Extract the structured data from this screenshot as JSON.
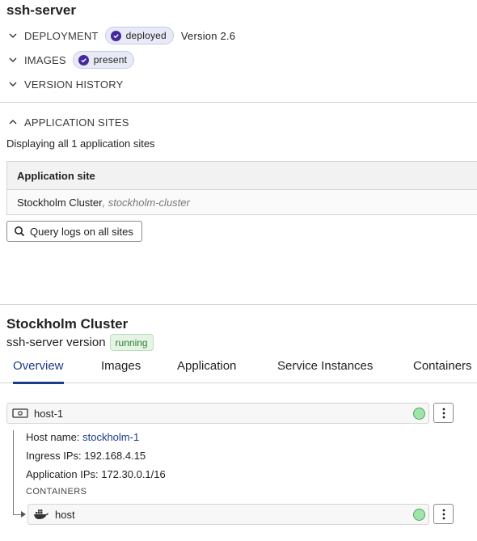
{
  "app": {
    "title": "ssh-server"
  },
  "sections": {
    "deployment": {
      "label": "DEPLOYMENT",
      "badge": "deployed",
      "version": "Version 2.6"
    },
    "images": {
      "label": "IMAGES",
      "badge": "present"
    },
    "version_history": {
      "label": "VERSION HISTORY"
    },
    "application_sites": {
      "label": "APPLICATION SITES",
      "summary": "Displaying all 1 application sites"
    }
  },
  "sites_table": {
    "header": "Application site",
    "rows": [
      {
        "name": "Stockholm Cluster",
        "slug": ", stockholm-cluster"
      }
    ]
  },
  "query_button": {
    "label": "Query logs on all sites",
    "icon": "search-icon"
  },
  "cluster": {
    "title": "Stockholm Cluster",
    "service_version": "ssh-server version",
    "status": "running"
  },
  "tabs": [
    {
      "label": "Overview",
      "active": true
    },
    {
      "label": "Images"
    },
    {
      "label": "Application"
    },
    {
      "label": "Service Instances"
    },
    {
      "label": "Containers"
    }
  ],
  "host": {
    "name": "host-1",
    "details": {
      "host_name_label": "Host name:",
      "host_name_value": "stockholm-1",
      "ingress": "Ingress IPs: 192.168.4.15",
      "application_ips": "Application IPs: 172.30.0.1/16"
    },
    "containers_label": "CONTAINERS",
    "containers": [
      {
        "name": "host",
        "icon": "docker-icon"
      }
    ]
  },
  "colors": {
    "accent": "#1e3a8a",
    "badge_bg": "#e8eaf6",
    "ok_purple": "#4527a0",
    "status_green": "#9ee6a7",
    "running_green": "#2e7d32"
  }
}
